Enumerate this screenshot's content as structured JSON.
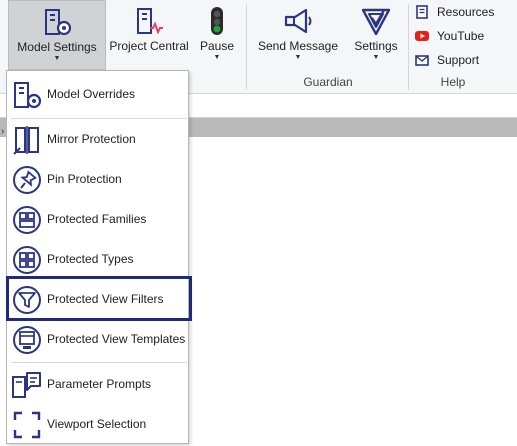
{
  "ribbon": {
    "buttons": [
      {
        "label": "Model Settings",
        "icon": "model-settings-icon",
        "has_dropdown": true
      },
      {
        "label": "Project Central",
        "icon": "project-central-icon",
        "has_dropdown": false
      },
      {
        "label": "Pause",
        "icon": "traffic-light-icon",
        "has_dropdown": true
      },
      {
        "label": "Send Message",
        "icon": "megaphone-icon",
        "has_dropdown": true
      },
      {
        "label": "Settings",
        "icon": "guardian-shield-icon",
        "has_dropdown": true
      }
    ],
    "groups": {
      "guardian": "Guardian",
      "help": "Help"
    },
    "help_items": [
      {
        "label": "Resources",
        "icon": "book-icon"
      },
      {
        "label": "YouTube",
        "icon": "youtube-icon"
      },
      {
        "label": "Support",
        "icon": "mail-icon"
      }
    ]
  },
  "dropdown": {
    "items": [
      {
        "label": "Model Overrides",
        "icon": "model-overrides-icon"
      },
      {
        "label": "Mirror Protection",
        "icon": "mirror-icon"
      },
      {
        "label": "Pin Protection",
        "icon": "pin-icon"
      },
      {
        "label": "Protected Families",
        "icon": "families-icon"
      },
      {
        "label": "Protected Types",
        "icon": "types-icon"
      },
      {
        "label": "Protected View Filters",
        "icon": "filter-icon",
        "highlighted": true
      },
      {
        "label": "Protected View Templates",
        "icon": "view-templates-icon"
      },
      {
        "label": "Parameter Prompts",
        "icon": "parameter-prompts-icon"
      },
      {
        "label": "Viewport Selection",
        "icon": "viewport-icon"
      }
    ]
  },
  "colors": {
    "icon_navy": "#2b3585",
    "highlight_border": "#202a7a",
    "youtube_red": "#e62117",
    "traffic_green": "#1fa33a"
  }
}
